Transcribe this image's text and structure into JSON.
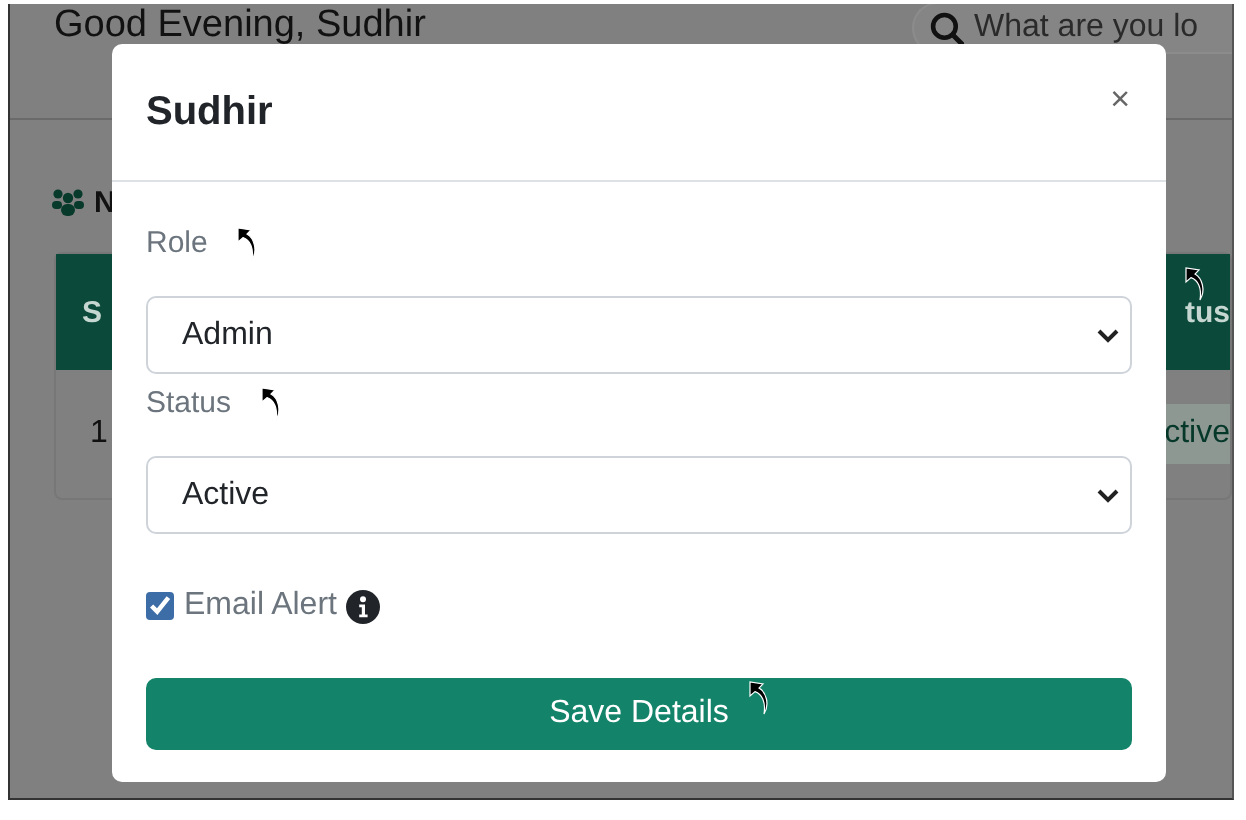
{
  "page": {
    "greeting": "Good Evening, Sudhir",
    "search": {
      "placeholder": "What are you lo"
    },
    "section_title": "N",
    "table": {
      "columns": [
        "S",
        "tus"
      ],
      "rows": [
        [
          "1",
          "ctive"
        ]
      ]
    }
  },
  "modal": {
    "title": "Sudhir",
    "close": "×",
    "fields": [
      {
        "label": "Role",
        "value": "Admin"
      },
      {
        "label": "Status",
        "value": "Active"
      }
    ],
    "checkbox": {
      "label": "Email Alert",
      "checked": true
    },
    "button": "Save Details"
  }
}
